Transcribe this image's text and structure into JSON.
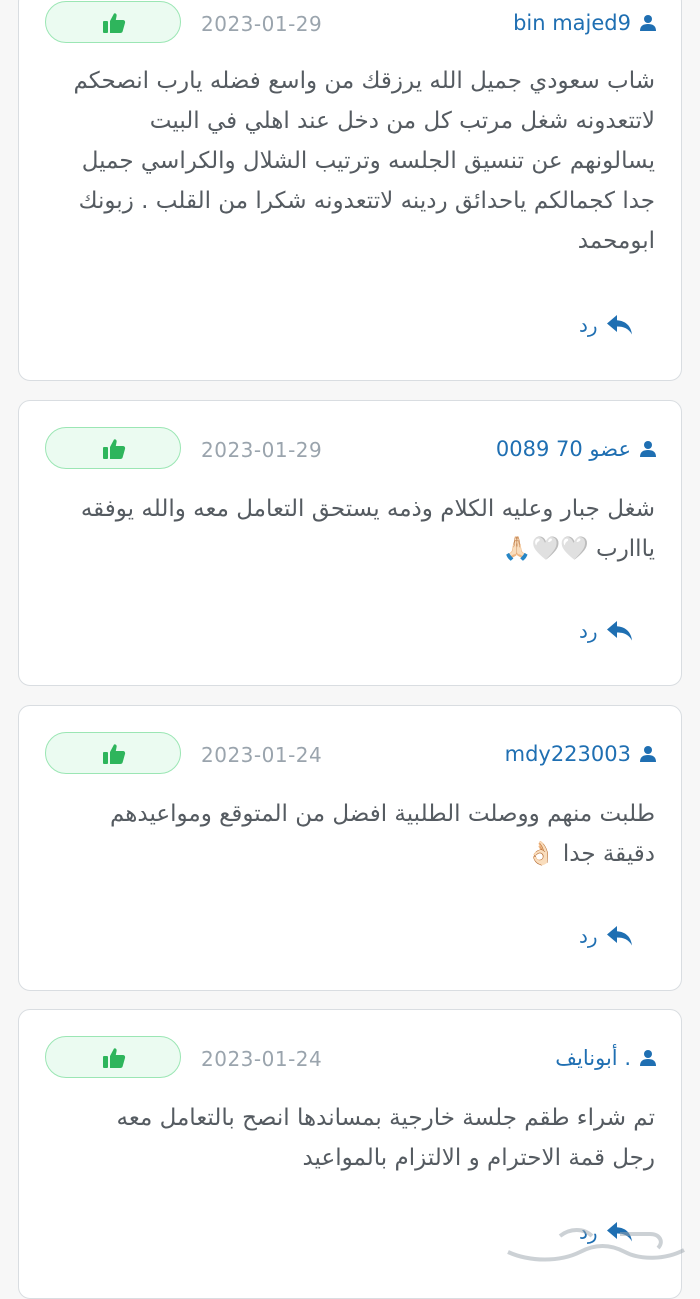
{
  "colors": {
    "author": "#1f6fb2",
    "date": "#9aa4ad",
    "body": "#555b61",
    "like_bg": "#ebfbf1",
    "like_border": "#9be6b4",
    "like_icon": "#2eb55c",
    "card_border": "#d9dde1"
  },
  "icons": {
    "author": "user-icon",
    "like": "thumbs-up-icon",
    "reply": "reply-arrow-icon"
  },
  "comments": [
    {
      "author": "bin majed9",
      "date": "2023-01-29",
      "text": "شاب سعودي جميل الله يرزقك من واسع فضله يارب انصحكم لاتتعدونه شغل مرتب كل من دخل عند اهلي في البيت يسالونهم عن تنسيق الجلسه وترتيب الشلال والكراسي جميل جدا كجمالكم ياحدائق ردينه لاتتعدونه شكرا من القلب . زبونك ابومحمد",
      "reply_label": "رد"
    },
    {
      "author": "عضو 70 0089",
      "date": "2023-01-29",
      "text": "شغل جبار وعليه الكلام وذمه يستحق التعامل معه والله يوفقه يااارب 🤍🤍🙏🏻",
      "reply_label": "رد"
    },
    {
      "author": "mdy223003",
      "date": "2023-01-24",
      "text": "طلبت منهم ووصلت الطلبية افضل من المتوقع ومواعيدهم دقيقة جدا 👌🏻",
      "reply_label": "رد"
    },
    {
      "author": "أبونايف .",
      "date": "2023-01-24",
      "text": "تم شراء طقم جلسة خارجية بمساندها انصح بالتعامل معه رجل قمة الاحترام و الالتزام بالمواعيد",
      "reply_label": "رد"
    }
  ]
}
